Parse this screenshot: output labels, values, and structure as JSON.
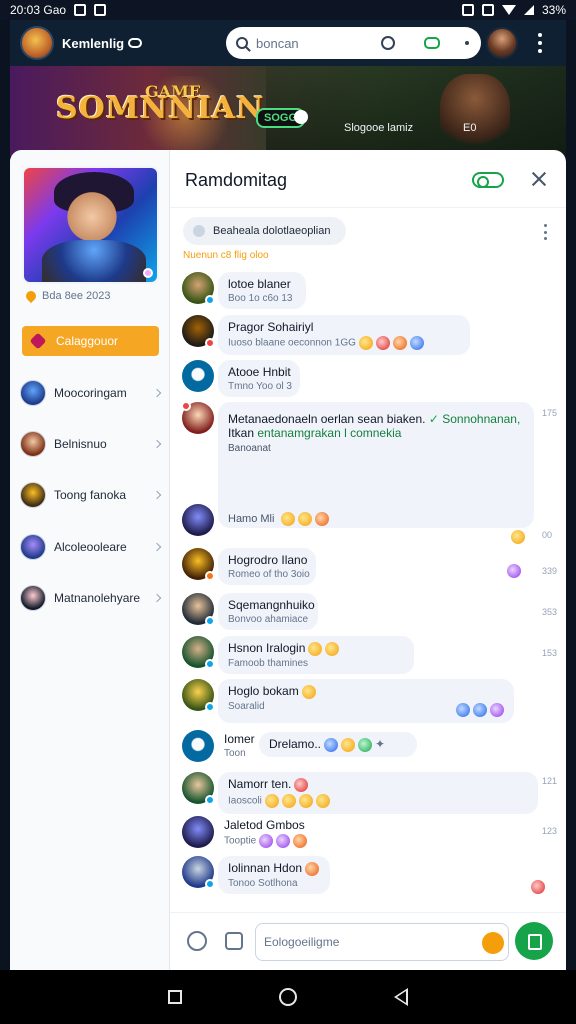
{
  "status_bar": {
    "time": "20:03 Gao",
    "battery": "33%"
  },
  "app_bar": {
    "title": "Kemlenlig",
    "search_placeholder": "boncan"
  },
  "banner": {
    "title_small": "GAME",
    "title": "SOMNNIAN",
    "pill": "SOGG",
    "caption": "Slogooe lamiz",
    "number": "E0"
  },
  "sidebar": {
    "date": "Bda 8ee 2023",
    "primary_button": "Calaggouor",
    "items": [
      {
        "label": "Moocoringam"
      },
      {
        "label": "Belnisnuo"
      },
      {
        "label": "Toong fanoka"
      },
      {
        "label": "Alcoleooleare"
      },
      {
        "label": "Matnanolehyare"
      }
    ]
  },
  "chat": {
    "title": "Ramdomitag",
    "search_chip": "Beaheala dolotlaeoplian",
    "section_label": "Nuenun c8 flig oloo",
    "messages": [
      {
        "name": "lotoe blaner",
        "sub": "Boo 1o c6o 13"
      },
      {
        "name": "Pragor Sohairiyl",
        "sub": "Iuoso blaane oeconnon",
        "extra": "1GG"
      },
      {
        "name": "Atooe Hnbit",
        "sub": "Tmno Yoo ol 3"
      },
      {
        "text_a": "Metanaedonaeln oerlan sean biaken.",
        "text_green": "Sonnohnanan,",
        "text_b": "Itkan",
        "text_green2": "entanamgrakan l comnekia",
        "text_c": "Banoanat",
        "time": "175"
      },
      {
        "name": "Hamo Mli",
        "time": "00"
      },
      {
        "name": "Hogrodro Ilano",
        "sub": "Romeo of tho 3oio",
        "time": "339"
      },
      {
        "name": "Sqemangnhuiko",
        "sub": "Bonvoo ahamiace",
        "time": "353"
      },
      {
        "name": "Hsnon Iralogin",
        "sub": "Famoob thamines",
        "time": "153"
      },
      {
        "name": "Hoglo bokam",
        "sub": "Soaralid"
      },
      {
        "name": "Iomer",
        "sub": "Toon",
        "bubble2": "Drelamo.."
      },
      {
        "name": "Namorr ten.",
        "sub": "Iaoscoli",
        "time": "121"
      },
      {
        "name": "Jaletod Gmbos",
        "sub": "Tooptie",
        "time": "123"
      },
      {
        "name": "Iolinnan Hdon",
        "sub": "Tonoo Sotlhona"
      }
    ]
  },
  "composer": {
    "placeholder": "Eologoeiligme"
  },
  "colors": {
    "accent_orange": "#f5a623",
    "accent_green": "#16a34a",
    "panel": "#ffffff"
  }
}
